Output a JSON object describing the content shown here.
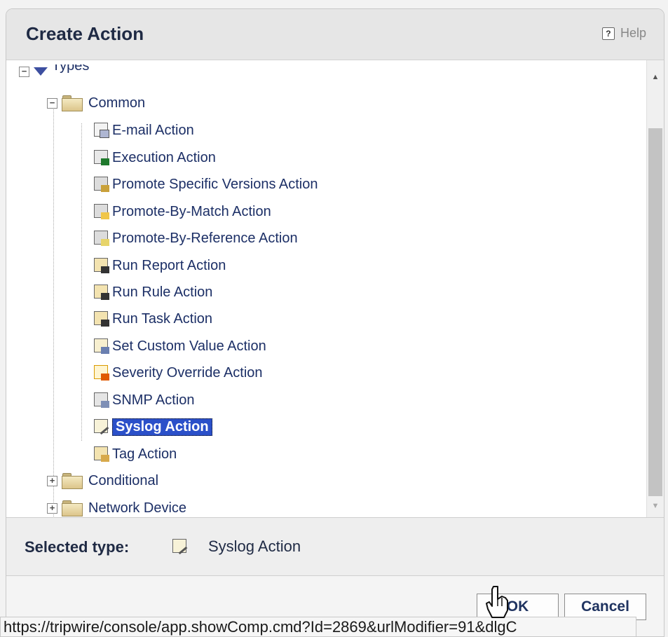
{
  "dialog": {
    "title": "Create Action",
    "help_label": "Help"
  },
  "tree": {
    "root_label": "Types",
    "folders": [
      {
        "label": "Common",
        "expanded": true
      },
      {
        "label": "Conditional",
        "expanded": false
      },
      {
        "label": "Network Device",
        "expanded": false
      }
    ],
    "items": [
      {
        "label": "E-mail Action",
        "icon": "email-action-icon"
      },
      {
        "label": "Execution Action",
        "icon": "execution-action-icon"
      },
      {
        "label": "Promote Specific Versions Action",
        "icon": "promote-specific-icon"
      },
      {
        "label": "Promote-By-Match Action",
        "icon": "promote-match-icon"
      },
      {
        "label": "Promote-By-Reference Action",
        "icon": "promote-reference-icon"
      },
      {
        "label": "Run Report Action",
        "icon": "run-report-icon"
      },
      {
        "label": "Run Rule Action",
        "icon": "run-rule-icon"
      },
      {
        "label": "Run Task Action",
        "icon": "run-task-icon"
      },
      {
        "label": "Set Custom Value Action",
        "icon": "custom-value-icon"
      },
      {
        "label": "Severity Override Action",
        "icon": "severity-override-icon"
      },
      {
        "label": "SNMP Action",
        "icon": "snmp-action-icon"
      },
      {
        "label": "Syslog Action",
        "icon": "syslog-action-icon",
        "selected": true
      },
      {
        "label": "Tag Action",
        "icon": "tag-action-icon"
      }
    ]
  },
  "selected": {
    "label": "Selected type:",
    "value": "Syslog Action"
  },
  "buttons": {
    "ok": "OK",
    "cancel": "Cancel"
  },
  "status_bar": {
    "url": "https://tripwire/console/app.showComp.cmd?Id=2869&urlModifier=91&dlgC"
  },
  "colors": {
    "selection": "#2b50c9",
    "text": "#1c2f66"
  }
}
